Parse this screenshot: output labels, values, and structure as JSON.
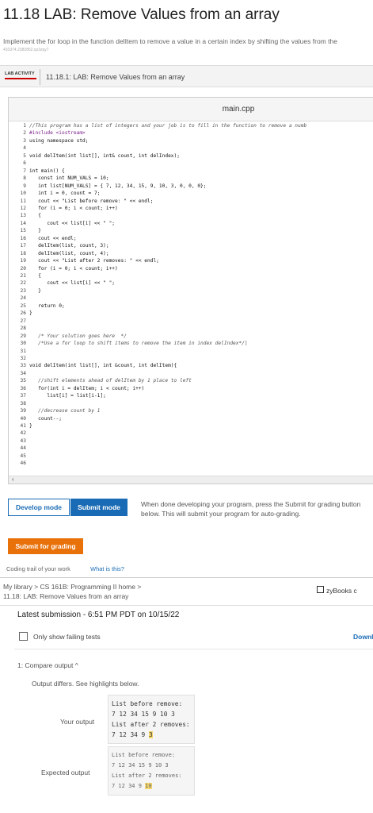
{
  "page": {
    "title": "11.18 LAB: Remove Values from an array",
    "description": "Implement the for loop in the function delItem to remove a value in a certain index by shifting the values from the",
    "hash": "410374.2382852.qx3zqy7"
  },
  "lab": {
    "tag": "LAB ACTIVITY",
    "title": "11.18.1: LAB: Remove Values from an array"
  },
  "editor": {
    "filename": "main.cpp",
    "lines": [
      {
        "n": "1",
        "t": "//This program has a list of integers and your job is to fill in the function to remove a numb",
        "k": "cm"
      },
      {
        "n": "2",
        "t": "#include <iostream>",
        "k": "pp"
      },
      {
        "n": "3",
        "t": "using namespace std;",
        "k": ""
      },
      {
        "n": "4",
        "t": "",
        "k": ""
      },
      {
        "n": "5",
        "t": "void delItem(int list[], int& count, int delIndex);",
        "k": ""
      },
      {
        "n": "6",
        "t": "",
        "k": ""
      },
      {
        "n": "7",
        "t": "int main() {",
        "k": ""
      },
      {
        "n": "8",
        "t": "   const int NUM_VALS = 10;",
        "k": ""
      },
      {
        "n": "9",
        "t": "   int list[NUM_VALS] = { 7, 12, 34, 15, 9, 10, 3, 0, 0, 0};",
        "k": ""
      },
      {
        "n": "10",
        "t": "   int i = 0, count = 7;",
        "k": ""
      },
      {
        "n": "11",
        "t": "   cout << \"List before remove: \" << endl;",
        "k": ""
      },
      {
        "n": "12",
        "t": "   for (i = 0; i < count; i++)",
        "k": ""
      },
      {
        "n": "13",
        "t": "   {",
        "k": ""
      },
      {
        "n": "14",
        "t": "      cout << list[i] << \" \";",
        "k": ""
      },
      {
        "n": "15",
        "t": "   }",
        "k": ""
      },
      {
        "n": "16",
        "t": "   cout << endl;",
        "k": ""
      },
      {
        "n": "17",
        "t": "   delItem(list, count, 3);",
        "k": ""
      },
      {
        "n": "18",
        "t": "   delItem(list, count, 4);",
        "k": ""
      },
      {
        "n": "19",
        "t": "   cout << \"List after 2 removes: \" << endl;",
        "k": ""
      },
      {
        "n": "20",
        "t": "   for (i = 0; i < count; i++)",
        "k": ""
      },
      {
        "n": "21",
        "t": "   {",
        "k": ""
      },
      {
        "n": "22",
        "t": "      cout << list[i] << \" \";",
        "k": ""
      },
      {
        "n": "23",
        "t": "   }",
        "k": ""
      },
      {
        "n": "24",
        "t": "",
        "k": ""
      },
      {
        "n": "25",
        "t": "   return 0;",
        "k": ""
      },
      {
        "n": "26",
        "t": "}",
        "k": ""
      },
      {
        "n": "27",
        "t": "",
        "k": ""
      },
      {
        "n": "28",
        "t": "",
        "k": ""
      },
      {
        "n": "29",
        "t": "   /* Your solution goes here  */",
        "k": "cm"
      },
      {
        "n": "30",
        "t": "   /*Use a for loop to shift items to remove the item in index delIndex*/|",
        "k": "cm"
      },
      {
        "n": "31",
        "t": "",
        "k": ""
      },
      {
        "n": "32",
        "t": "",
        "k": ""
      },
      {
        "n": "33",
        "t": "void delItem(int list[], int &count, int delItem){",
        "k": ""
      },
      {
        "n": "34",
        "t": "",
        "k": ""
      },
      {
        "n": "35",
        "t": "   //shift elements ahead of delItem by 1 place to left",
        "k": "cm"
      },
      {
        "n": "36",
        "t": "   for(int i = delItem; i < count; i++)",
        "k": ""
      },
      {
        "n": "37",
        "t": "      list[i] = list[i-1];",
        "k": ""
      },
      {
        "n": "38",
        "t": "",
        "k": ""
      },
      {
        "n": "39",
        "t": "   //decrease count by 1",
        "k": "cm"
      },
      {
        "n": "40",
        "t": "   count--;",
        "k": ""
      },
      {
        "n": "41",
        "t": "}",
        "k": ""
      },
      {
        "n": "42",
        "t": "",
        "k": ""
      },
      {
        "n": "43",
        "t": "",
        "k": ""
      },
      {
        "n": "44",
        "t": "",
        "k": ""
      },
      {
        "n": "45",
        "t": "",
        "k": ""
      },
      {
        "n": "46",
        "t": "",
        "k": ""
      }
    ]
  },
  "controls": {
    "develop_mode": "Develop mode",
    "submit_mode": "Submit mode",
    "hint": "When done developing your program, press the Submit for grading button below. This will submit your program for auto-grading.",
    "submit_for_grading": "Submit for grading",
    "coding_trail": "Coding trail of your work",
    "what_is_this": "What is this?"
  },
  "breadcrumb": {
    "line1": "My library > CS 161B: Programming II home >",
    "line2": "11.18: LAB: Remove Values from an array",
    "zybooks": "zyBooks c"
  },
  "submission": {
    "latest": "Latest submission - 6:51 PM PDT on 10/15/22",
    "only_failing": "Only show failing tests",
    "download": "Downl",
    "compare_heading": "1: Compare output ^",
    "differs": "Output differs. See highlights below.",
    "your_output_label": "Your output",
    "your_output": {
      "l1": "List before remove:",
      "l2": "7 12 34 15 9 10 3",
      "l3": "List after 2 removes:",
      "l4a": "7 12 34 9 ",
      "l4b": "3"
    },
    "expected_label": "Expected output",
    "expected_output": {
      "l1": "List before remove:",
      "l2": "7 12 34 15 9 10 3",
      "l3": "List after 2 removes:",
      "l4a": "7 12 34 9 ",
      "l4b": "10"
    },
    "highlight_color": "#f5d76e"
  }
}
